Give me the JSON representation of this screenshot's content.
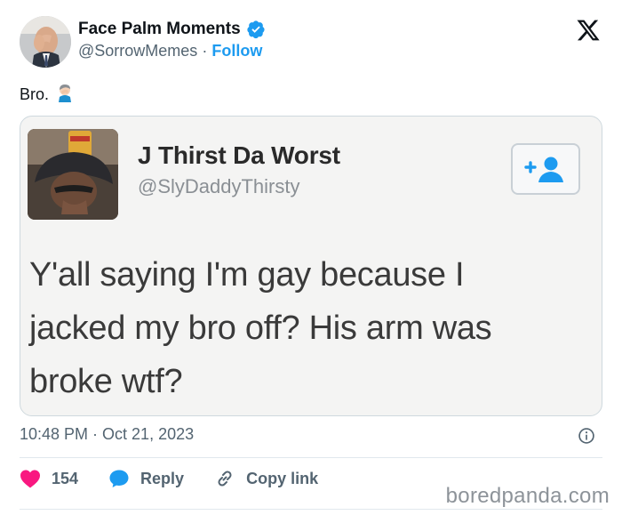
{
  "post": {
    "author_name": "Face Palm Moments",
    "author_handle": "@SorrowMemes",
    "separator": "·",
    "follow_label": "Follow",
    "text": "Bro.",
    "emoji": "🤦🏻‍♂️",
    "timestamp": "10:48 PM · Oct 21, 2023"
  },
  "embedded_tweet": {
    "author_name": "J Thirst Da Worst",
    "author_handle": "@SlyDaddyThirsty",
    "body_lines": [
      "Y'all saying I'm gay because I",
      "jacked my bro off?  His arm was",
      "broke wtf?"
    ]
  },
  "actions": {
    "like_count": "154",
    "reply_label": "Reply",
    "copy_link_label": "Copy link"
  },
  "watermark": "boredpanda.com",
  "colors": {
    "accent": "#1d9bf0",
    "like": "#f91880",
    "text_secondary": "#536471"
  },
  "icons": {
    "brand": "x-logo-icon",
    "verified": "verified-badge-icon",
    "info": "info-icon",
    "like": "heart-icon",
    "reply": "reply-bubble-icon",
    "copy": "link-icon",
    "add_user": "add-user-icon"
  }
}
